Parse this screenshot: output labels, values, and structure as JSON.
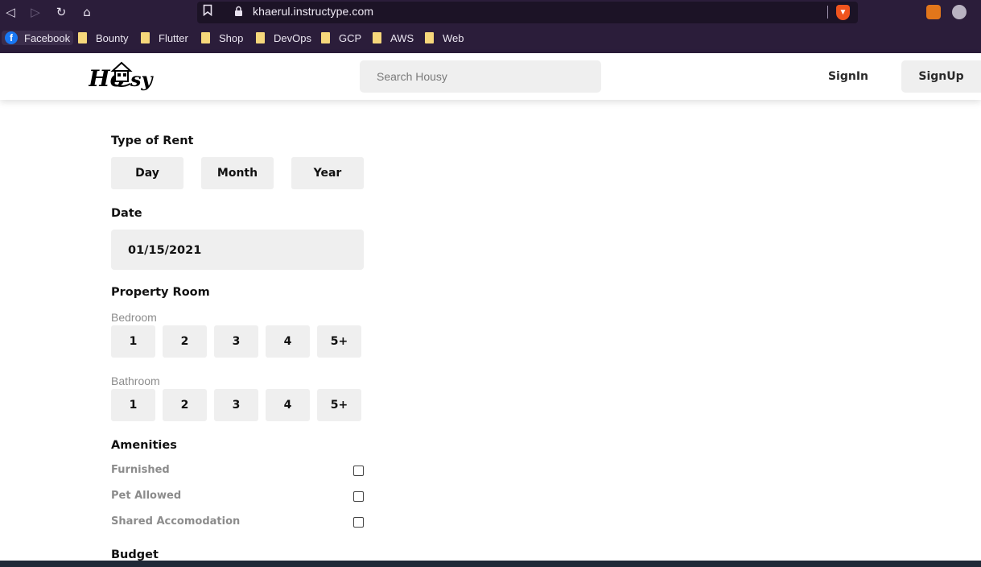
{
  "browser": {
    "url": "khaerul.instructype.com",
    "bookmarks": [
      "Facebook",
      "Bounty",
      "Flutter",
      "Shop",
      "DevOps",
      "GCP",
      "AWS",
      "Web"
    ]
  },
  "header": {
    "search_placeholder": "Search Housy",
    "signin_label": "SignIn",
    "signup_label": "SignUp"
  },
  "filters": {
    "rent_type": {
      "heading": "Type of Rent",
      "options": [
        "Day",
        "Month",
        "Year"
      ]
    },
    "date": {
      "heading": "Date",
      "value": "01/15/2021"
    },
    "property_room": {
      "heading": "Property Room",
      "bedroom_label": "Bedroom",
      "bedroom_options": [
        "1",
        "2",
        "3",
        "4",
        "5+"
      ],
      "bathroom_label": "Bathroom",
      "bathroom_options": [
        "1",
        "2",
        "3",
        "4",
        "5+"
      ]
    },
    "amenities": {
      "heading": "Amenities",
      "items": [
        {
          "label": "Furnished",
          "checked": false
        },
        {
          "label": "Pet Allowed",
          "checked": false
        },
        {
          "label": "Shared Accomodation",
          "checked": false
        }
      ]
    },
    "budget": {
      "heading": "Budget"
    }
  },
  "colors": {
    "browser_chrome": "#2b1d3a",
    "chip_background": "#efefef",
    "muted_text": "#8c8c8c"
  }
}
